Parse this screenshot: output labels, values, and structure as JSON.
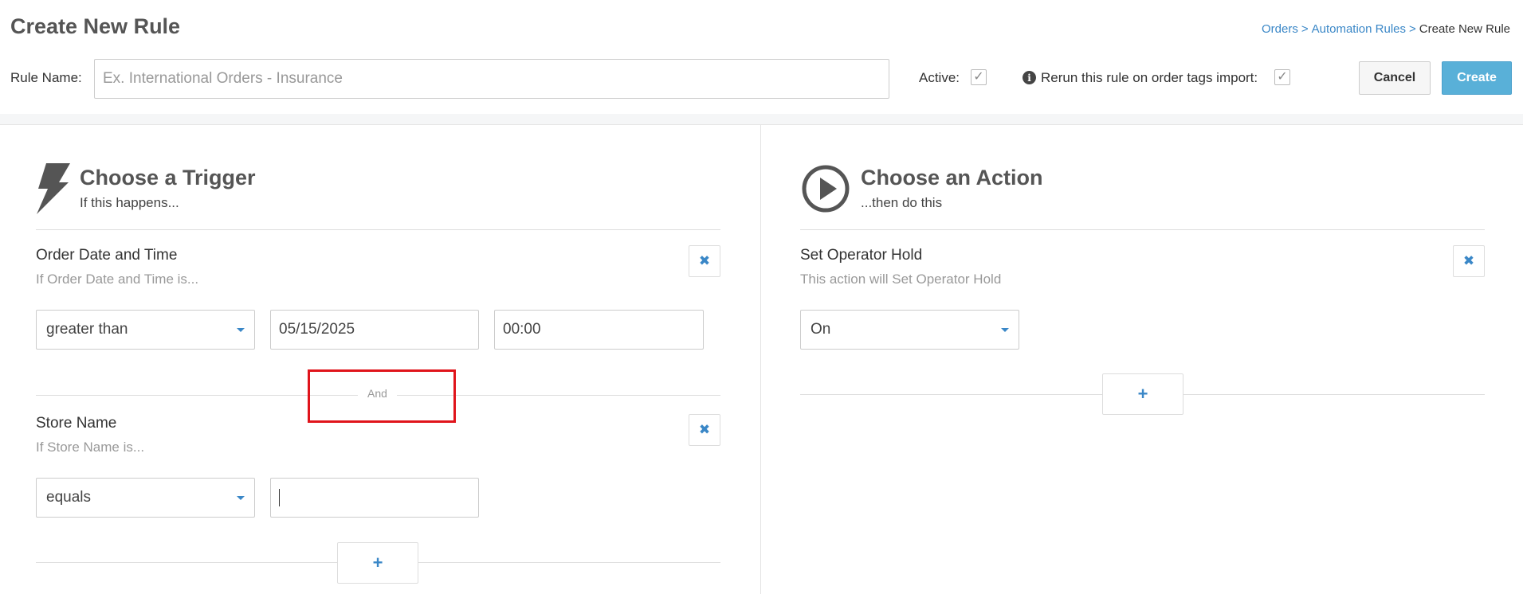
{
  "header": {
    "title": "Create New Rule",
    "breadcrumb": {
      "orders": "Orders",
      "automation_rules": "Automation Rules",
      "current": "Create New Rule",
      "separator": ">"
    }
  },
  "rule_bar": {
    "name_label": "Rule Name:",
    "name_value": "",
    "name_placeholder": "Ex. International Orders - Insurance",
    "active_label": "Active:",
    "active_checked": true,
    "rerun_label": "Rerun this rule on order tags import:",
    "rerun_checked": true,
    "cancel_label": "Cancel",
    "create_label": "Create"
  },
  "trigger": {
    "icon": "lightning-bolt-icon",
    "title": "Choose a Trigger",
    "subtitle": "If this happens...",
    "conjunction": "And",
    "conditions": [
      {
        "title": "Order Date and Time",
        "description": "If Order Date and Time is...",
        "operator": "greater than",
        "date": "05/15/2025",
        "time": "00:00"
      },
      {
        "title": "Store Name",
        "description": "If Store Name is...",
        "operator": "equals",
        "value": ""
      }
    ]
  },
  "action": {
    "icon": "play-circle-icon",
    "title": "Choose an Action",
    "subtitle": "...then do this",
    "actions": [
      {
        "title": "Set Operator Hold",
        "description": "This action will Set Operator Hold",
        "value": "On"
      }
    ]
  },
  "icons": {
    "remove": "✖",
    "add": "+",
    "check": "✓",
    "info": "i"
  },
  "colors": {
    "link": "#3a87c7",
    "create_button": "#59b0d8",
    "highlight": "#e0141b"
  }
}
